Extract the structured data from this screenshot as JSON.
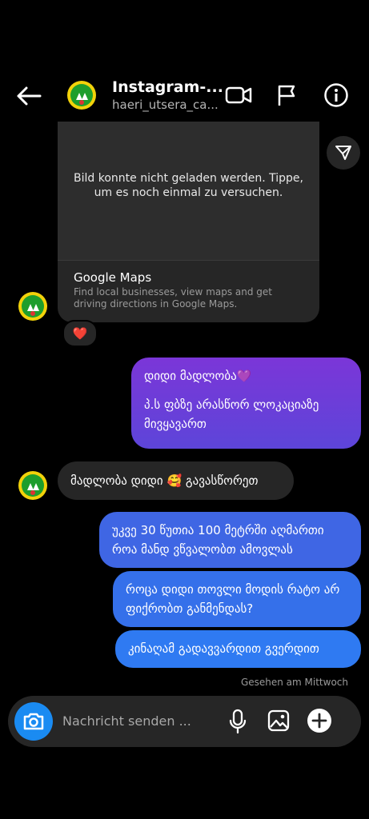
{
  "header": {
    "title": "Instagram-...",
    "username": "haeri_utsera_ca...",
    "back_icon": "back-arrow-icon",
    "video_icon": "video-camera-icon",
    "flag_icon": "flag-icon",
    "info_icon": "info-icon"
  },
  "link_card": {
    "image_error": "Bild konnte nicht geladen werden. Tippe, um es noch einmal zu versuchen.",
    "title": "Google Maps",
    "description": "Find local businesses, view maps and get driving directions in Google Maps."
  },
  "reaction": "❤️",
  "messages": [
    {
      "line1": "დიდი მადლობა💜",
      "line2": "პ.ს ფბზე არასწორ ლოკაციაზე მივყავართ"
    },
    {
      "text": "მადლობა დიდი 🥰 გავასწორეთ"
    },
    {
      "text": "უკვე 30 წუთია 100 მეტრში აღმართი როა მანდ ვწვალობთ ამოვლას"
    },
    {
      "text": "როცა დიდი თოვლი მოდის რატო არ ფიქრობთ განმენდას?"
    },
    {
      "text": "კინაღამ გადავვარდით გვერდით"
    }
  ],
  "seen_status": "Gesehen am Mittwoch",
  "composer": {
    "placeholder": "Nachricht senden ...",
    "camera_icon": "camera-icon",
    "mic_icon": "microphone-icon",
    "gallery_icon": "gallery-icon",
    "add_icon": "plus-icon"
  },
  "colors": {
    "background": "#000000",
    "received_bubble": "#262626",
    "sent_purple": "#7b36d8",
    "sent_blue": "#3f66e4",
    "camera_button": "#1a8bf2",
    "avatar_yellow": "#f2d20a"
  }
}
